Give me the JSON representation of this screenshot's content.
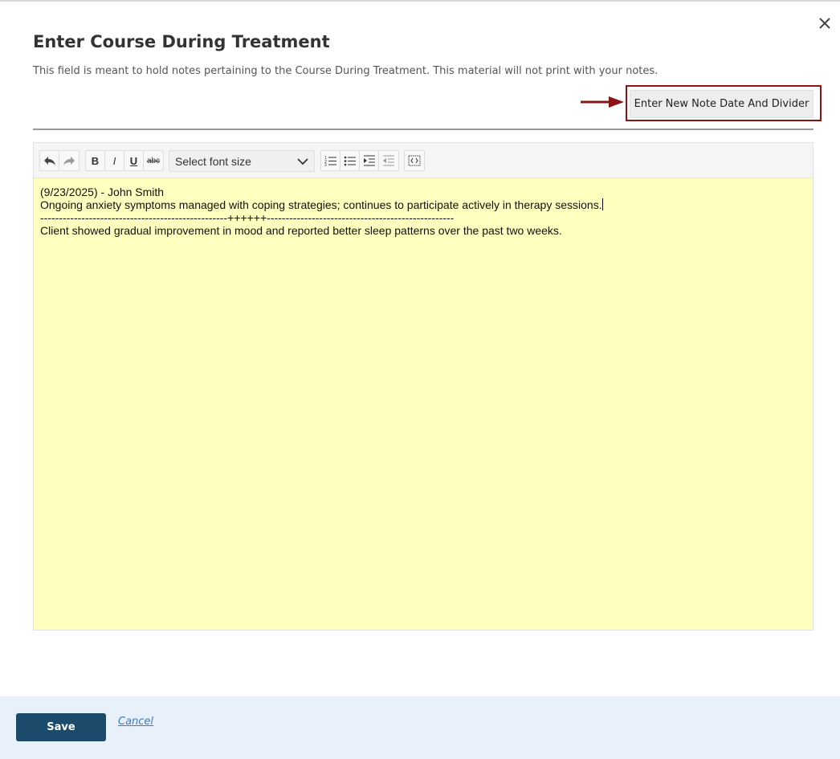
{
  "dialog": {
    "title": "Enter Course During Treatment",
    "description": "This field is meant to hold notes pertaining to the Course During Treatment. This material will not print with your notes.",
    "note_button_label": "Enter New Note Date And Divider",
    "close_icon": "close-icon",
    "highlight_color": "#8b1414"
  },
  "toolbar": {
    "undo_icon": "undo-icon",
    "redo_icon": "redo-icon",
    "bold_label": "B",
    "italic_label": "I",
    "underline_label": "U",
    "strike_label": "abc",
    "font_size_placeholder": "Select font size",
    "ordered_list_icon": "ordered-list-icon",
    "bullet_list_icon": "bullet-list-icon",
    "indent_icon": "indent-icon",
    "outdent_icon": "outdent-icon",
    "source_icon": "source-code-icon"
  },
  "editor": {
    "background_color": "#ffffc0",
    "lines": [
      "(9/23/2025) - John Smith",
      "Ongoing anxiety symptoms managed with coping strategies; continues to participate actively in therapy sessions.",
      "--------------------------------------------------++++++--------------------------------------------------",
      "",
      "",
      "Client showed gradual improvement in mood and reported better sleep patterns over the past two weeks."
    ]
  },
  "footer": {
    "save_label": "Save",
    "cancel_label": "Cancel",
    "save_color": "#1b4a6b"
  }
}
